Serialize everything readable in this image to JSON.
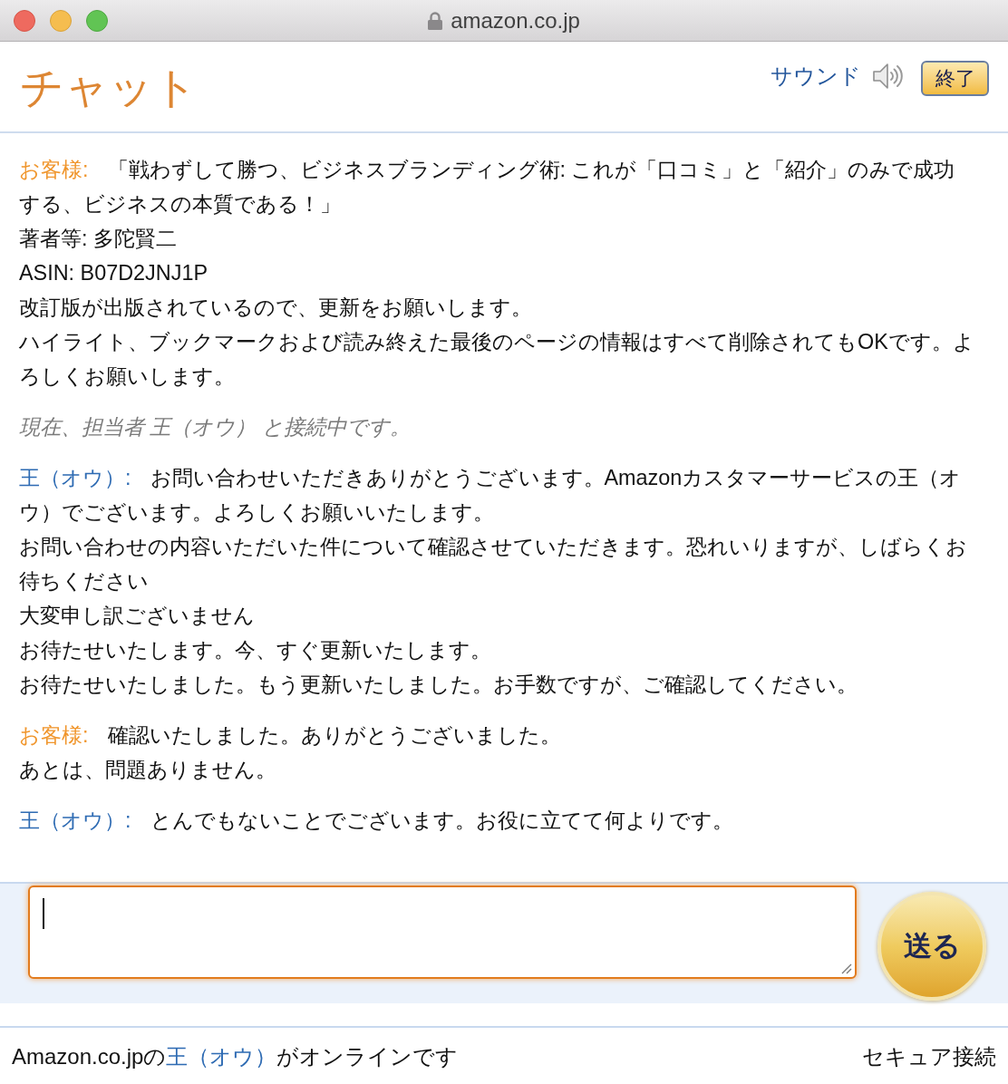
{
  "window": {
    "url": "amazon.co.jp"
  },
  "header": {
    "title": "チャット",
    "sound": {
      "label": "サウンド",
      "on": true
    },
    "end_button": "終了"
  },
  "messages": [
    {
      "kind": "customer_message",
      "speaker": "お客様:",
      "lines": [
        "「戦わずして勝つ、ビジネスブランディング術: これが「口コミ」と「紹介」のみで成功",
        "する、ビジネスの本質である！」",
        "著者等: 多陀賢二",
        "ASIN: B07D2JNJ1P",
        "改訂版が出版されているので、更新をお願いします。",
        "ハイライト、ブックマークおよび読み終えた最後のページの情報はすべて削除されてもOKです。よろしくお願いします。"
      ]
    },
    {
      "kind": "notice",
      "text": "現在、担当者 王（オウ） と接続中です。"
    },
    {
      "kind": "agent_message",
      "speaker": "王（オウ）:",
      "lines": [
        "お問い合わせいただきありがとうございます。Amazonカスタマーサービスの王（オ",
        "ウ）でございます。よろしくお願いいたします。",
        "お問い合わせの内容いただいた件について確認させていただきます。恐れいりますが、しばらくお待ちください",
        "大変申し訳ございません",
        "お待たせいたします。今、すぐ更新いたします。",
        "お待たせいたしました。もう更新いたしました。お手数ですが、ご確認してください。"
      ]
    },
    {
      "kind": "customer_message",
      "speaker": "お客様:",
      "lines": [
        "確認いたしました。ありがとうございました。",
        "あとは、問題ありません。"
      ]
    },
    {
      "kind": "agent_message",
      "speaker": "王（オウ）:",
      "lines": [
        "とんでもないことでございます。お役に立てて何よりです。"
      ]
    }
  ],
  "composer": {
    "focused": true,
    "send_button": "送る"
  },
  "status_bar": {
    "prefix": "Amazon.co.jpの",
    "agent": "王（オウ）",
    "suffix": "がオンラインです",
    "security": "セキュア接続"
  }
}
